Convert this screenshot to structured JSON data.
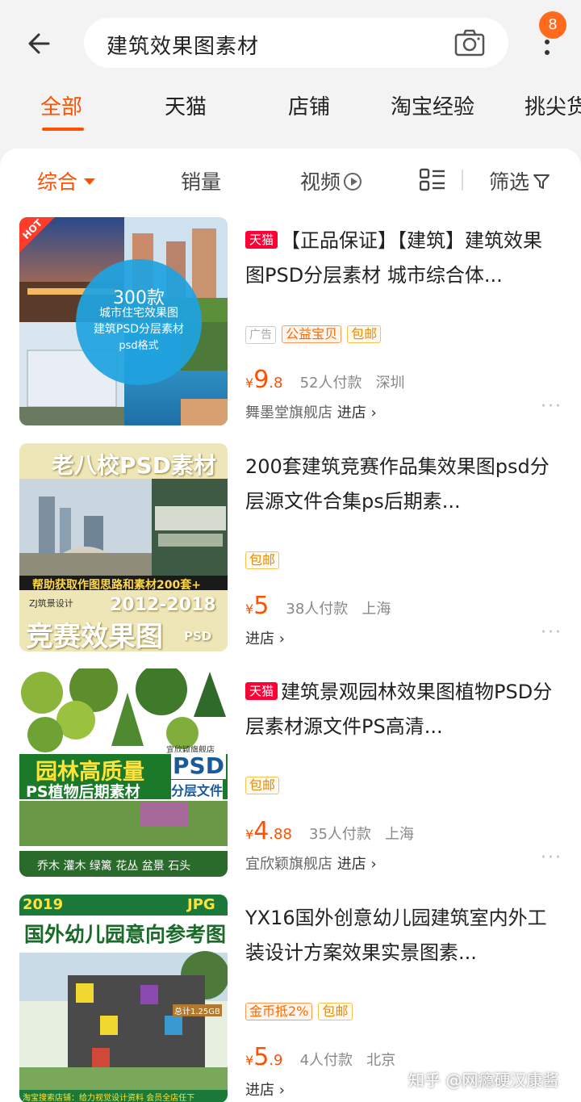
{
  "search": {
    "query": "建筑效果图素材",
    "badge_count": "8"
  },
  "category_tabs": [
    "全部",
    "天猫",
    "店铺",
    "淘宝经验",
    "挑尖货"
  ],
  "sort_bar": {
    "comprehensive": "综合",
    "sales": "销量",
    "video": "视频",
    "filter": "筛选"
  },
  "products": [
    {
      "tmall": "天猫",
      "title": "【正品保证】【建筑】建筑效果图PSD分层素材 城市综合体...",
      "tags": [
        "广告",
        "公益宝贝",
        "包邮"
      ],
      "price_yen": "¥",
      "price_int": "9",
      "price_dec": ".8",
      "sales": "52人付款",
      "location": "深圳",
      "shop": "舞墨堂旗舰店",
      "enter": "进店",
      "image": {
        "hot": "HOT",
        "count": "300款",
        "line1": "城市住宅效果图",
        "line2": "建筑PSD分层素材",
        "line3": "psd格式"
      }
    },
    {
      "tmall": "",
      "title": "200套建筑竞赛作品集效果图psd分层源文件合集ps后期素...",
      "tags": [
        "包邮"
      ],
      "price_yen": "¥",
      "price_int": "5",
      "price_dec": "",
      "sales": "38人付款",
      "location": "上海",
      "shop": "",
      "enter": "进店",
      "image": {
        "header": "老八校PSD素材",
        "banner": "帮助获取作图思路和素材200套+",
        "designer": "ZJ筑景设计",
        "years": "2012-2018",
        "big": "竞赛效果图",
        "psd": "PSD"
      }
    },
    {
      "tmall": "天猫",
      "title": "建筑景观园林效果图植物PSD分层素材源文件PS高清...",
      "tags": [
        "包邮"
      ],
      "price_yen": "¥",
      "price_int": "4",
      "price_dec": ".88",
      "sales": "35人付款",
      "location": "上海",
      "shop": "宜欣颖旗舰店",
      "enter": "进店",
      "image": {
        "store": "宜欣颖旗舰店",
        "main": "园林高质量",
        "sub": "PS植物后期素材",
        "psd": "PSD",
        "layers": "分层文件",
        "bottom": "乔木 灌木 绿篱 花丛 盆景 石头"
      }
    },
    {
      "tmall": "",
      "title": "YX16国外创意幼儿园建筑室内外工装设计方案效果实景图素...",
      "tags": [
        "金币抵2%",
        "包邮"
      ],
      "price_yen": "¥",
      "price_int": "5",
      "price_dec": ".9",
      "sales": "4人付款",
      "location": "北京",
      "shop": "",
      "enter": "进店",
      "image": {
        "year": "2019",
        "format": "JPG",
        "main": "国外幼儿园意向参考图",
        "size": "总计1.25GB",
        "footer": "淘宝搜索店铺：给力视觉设计资料 会员全店任下"
      }
    }
  ],
  "watermark": "知乎 @网瘾硬汉康酱"
}
